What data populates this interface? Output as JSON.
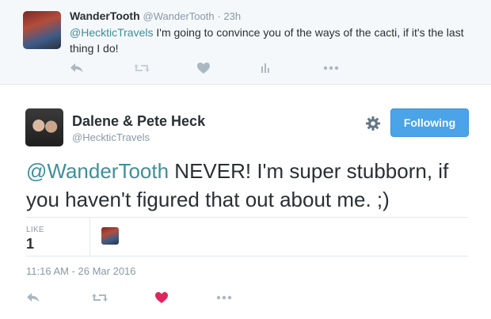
{
  "parent_tweet": {
    "author_name": "WanderTooth",
    "author_handle": "@WanderTooth",
    "time": "· 23h",
    "mention": "@HeckticTravels",
    "text": " I'm going to convince you of the ways of the cacti, if it's the last thing I do!"
  },
  "main_tweet": {
    "author_name": "Dalene & Pete Heck",
    "author_handle": "@HeckticTravels",
    "follow_label": "Following",
    "mention": "@WanderTooth",
    "text": " NEVER! I'm super stubborn, if you haven't figured that out about me. ;)",
    "likes_label": "LIKE",
    "likes_count": "1",
    "timestamp": "11:16 AM - 26 Mar 2016"
  },
  "colors": {
    "accent_blue": "#4ba3e8",
    "mention": "#3f8f9a",
    "liked_heart": "#e0245e",
    "muted_icon": "#aab8c2"
  },
  "icons": {
    "reply": "reply-icon",
    "retweet": "retweet-icon",
    "like": "heart-icon",
    "analytics": "analytics-icon",
    "more": "more-icon",
    "settings": "gear-icon"
  }
}
